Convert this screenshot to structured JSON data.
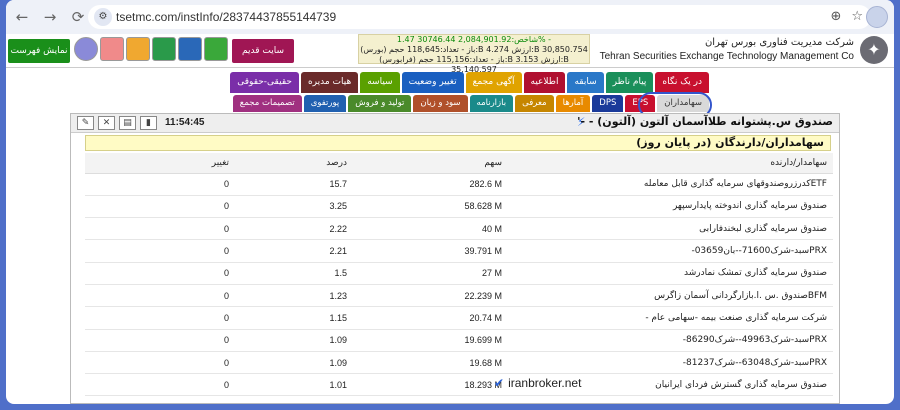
{
  "browser": {
    "back": "←",
    "forward": "→",
    "reload": "⟳",
    "site_info": "⚙",
    "url": "tsetmc.com/instInfo/28374437855144739",
    "zoom": "⊕",
    "star": "☆"
  },
  "header": {
    "company_fa": "شرکت مدیریت فناوری بورس تهران",
    "company_en": "Tehran Securities Exchange Technology Management Co",
    "ticker_lines": [
      "شاخص:2,084,901.92 30746.44 1.47% -",
      "(بورس) باز - تعداد:118,645 حجم:B 4.274 ارزش:B 30,850.754",
      "(فرابورس) باز - تعداد:115,156 حجم:B 3.153 ارزش:B 35,140.597"
    ],
    "list_button": "نمایش فهرست",
    "old_site": "سایت قدیم"
  },
  "tabs_row1": [
    {
      "label": "در یک نگاه",
      "color": "#c8102e"
    },
    {
      "label": "پیام ناظر",
      "color": "#1a8f5a"
    },
    {
      "label": "سابقه",
      "color": "#2a78c8"
    },
    {
      "label": "اطلاعیه",
      "color": "#b01030"
    },
    {
      "label": "آگهی مجمع",
      "color": "#e0a300"
    },
    {
      "label": "تغییر وضعیت",
      "color": "#1a5fc0"
    },
    {
      "label": "سیاسه",
      "color": "#5aa000"
    },
    {
      "label": "هیات مدیره",
      "color": "#6a2a2a"
    },
    {
      "label": "حقیقی-حقوقی",
      "color": "#7a2ea8"
    }
  ],
  "tabs_row2": [
    {
      "label": "سهامداران",
      "color": "#888888",
      "active": true
    },
    {
      "label": "EPS",
      "color": "#c8102e"
    },
    {
      "label": "DPS",
      "color": "#1a3a9a"
    },
    {
      "label": "آمارها",
      "color": "#e88a00"
    },
    {
      "label": "معرفی",
      "color": "#c68600"
    },
    {
      "label": "بازارنامه",
      "color": "#1a8a8a"
    },
    {
      "label": "سود و زیان",
      "color": "#b0502a"
    },
    {
      "label": "تولید و فروش",
      "color": "#4a8a2a"
    },
    {
      "label": "پورتفوی",
      "color": "#2060b0"
    },
    {
      "label": "تصمیمات مجمع",
      "color": "#a03080"
    }
  ],
  "instrument": {
    "title": "صندوق س.پشتوانه طلاآسمان آلتون (آلتون) - -'",
    "time": "11:54:45"
  },
  "section_title": "سهامداران/دارندگان (در پایان روز)",
  "table": {
    "headers": {
      "holder": "سهامدار/دارنده",
      "share": "سهم",
      "pct": "درصد",
      "change": "تغییر"
    },
    "rows": [
      {
        "holder": "ETFکدرزروصندوقهای سرمایه گذاری قابل معامله",
        "share": "282.6 M",
        "pct": "15.7",
        "change": "0"
      },
      {
        "holder": "صندوق سرمایه گذاری اندوخته پایدارسپهر",
        "share": "58.628 M",
        "pct": "3.25",
        "change": "0"
      },
      {
        "holder": "صندوق سرمایه گذاری لبخندفارابی",
        "share": "40 M",
        "pct": "2.22",
        "change": "0"
      },
      {
        "holder": "PRXسبد-شرک71600--بان03659-",
        "share": "39.791 M",
        "pct": "2.21",
        "change": "0"
      },
      {
        "holder": "صندوق سرمایه گذاری تمشک نمادرشد",
        "share": "27 M",
        "pct": "1.5",
        "change": "0"
      },
      {
        "holder": "BFMصندوق .س .ا.بازارگردانی آسمان زاگرس",
        "share": "22.239 M",
        "pct": "1.23",
        "change": "0"
      },
      {
        "holder": "شرکت سرمایه گذاری صنعت بیمه -سهامی عام -",
        "share": "20.74 M",
        "pct": "1.15",
        "change": "0"
      },
      {
        "holder": "PRXسبد-شرک49963--شرک86290-",
        "share": "19.699 M",
        "pct": "1.09",
        "change": "0"
      },
      {
        "holder": "PRXسبد-شرک63048--شرک81237-",
        "share": "19.68 M",
        "pct": "1.09",
        "change": "0"
      },
      {
        "holder": "صندوق سرمایه گذاری گسترش فردای ایرانیان",
        "share": "18.293 M",
        "pct": "1.01",
        "change": "0"
      }
    ]
  },
  "watermark": "iranbroker.net"
}
